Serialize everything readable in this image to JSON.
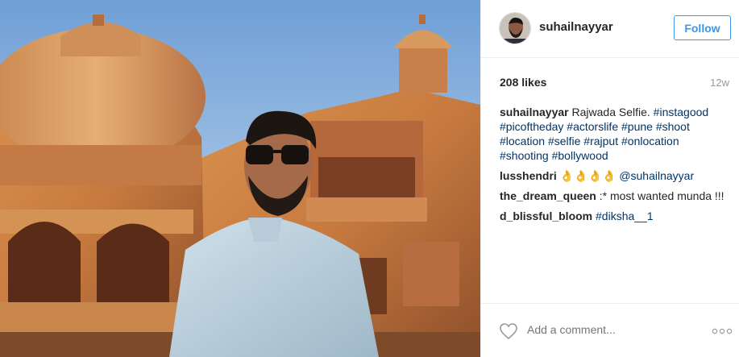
{
  "post": {
    "username": "suhailnayyar",
    "follow_label": "Follow",
    "likes": "208 likes",
    "time_ago": "12w"
  },
  "caption": {
    "user": "suhailnayyar",
    "text_pre": "Rajwada Selfie.",
    "tags": [
      "#instagood",
      "#picoftheday",
      "#actorslife",
      "#pune",
      "#shoot",
      "#location",
      "#selfie",
      "#rajput",
      "#onlocation",
      "#shooting",
      "#bollywood"
    ]
  },
  "comments": [
    {
      "user": "lusshendri",
      "text": "👌👌👌👌",
      "mention": "@suhailnayyar"
    },
    {
      "user": "the_dream_queen",
      "text": ":* most wanted munda !!!"
    },
    {
      "user": "d_blissful_bloom",
      "tag": "#diksha__1"
    }
  ],
  "footer": {
    "comment_placeholder": "Add a comment...",
    "icons": {
      "like": "heart-icon",
      "more": "more-options-icon"
    }
  },
  "colors": {
    "accent": "#3897f0",
    "hashtag": "#003569",
    "muted": "#999999"
  }
}
